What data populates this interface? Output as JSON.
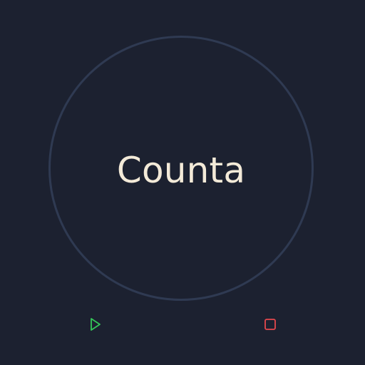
{
  "app": {
    "title": "Counta"
  },
  "controls": {
    "play": {
      "icon": "play-icon",
      "color": "#34c759"
    },
    "stop": {
      "icon": "stop-icon",
      "color": "#e5484d"
    }
  },
  "theme": {
    "background": "#1c2130",
    "ring": "#2f3a52",
    "text": "#f3ead8"
  }
}
